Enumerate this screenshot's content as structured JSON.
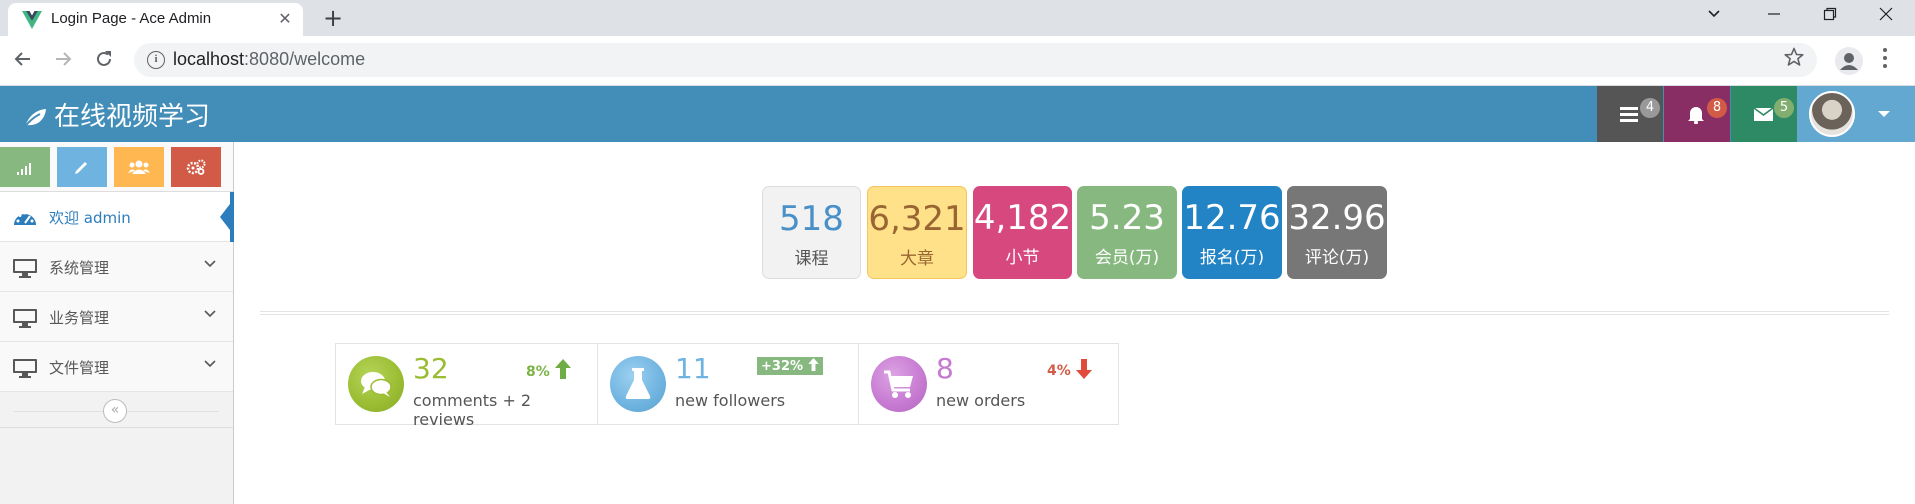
{
  "browser": {
    "tab_title": "Login Page - Ace Admin",
    "url_host": "localhost",
    "url_path": ":8080/welcome",
    "close_glyph": "✕",
    "new_tab_glyph": "+",
    "window_buttons": [
      "minimize",
      "restore",
      "close"
    ]
  },
  "navbar": {
    "brand": "在线视频学习",
    "badges": [
      {
        "icon": "tasks-icon",
        "count": "4",
        "color": "#555555"
      },
      {
        "icon": "bell-icon",
        "count": "8",
        "color": "#892e65"
      },
      {
        "icon": "envelope-icon",
        "count": "5",
        "color": "#2e8965"
      }
    ],
    "user_block_color": "#62a8d1"
  },
  "sidebar": {
    "shortcuts": [
      {
        "icon": "signal-icon",
        "color": "#87b87f"
      },
      {
        "icon": "pencil-icon",
        "color": "#6fb3e0"
      },
      {
        "icon": "users-icon",
        "color": "#ffb752"
      },
      {
        "icon": "cogs-icon",
        "color": "#d15b47"
      }
    ],
    "items": [
      {
        "label": "欢迎 admin",
        "icon": "dashboard-icon",
        "active": true
      },
      {
        "label": "系统管理",
        "icon": "desktop-icon"
      },
      {
        "label": "业务管理",
        "icon": "desktop-icon"
      },
      {
        "label": "文件管理",
        "icon": "desktop-icon"
      }
    ],
    "collapse_glyph": "«"
  },
  "stats": [
    {
      "value": "518",
      "label": "课程",
      "bg": "#f2f2f2",
      "color": "#4a90c8"
    },
    {
      "value": "6,321",
      "label": "大章",
      "bg": "#fee188",
      "color": "#996633"
    },
    {
      "value": "4,182",
      "label": "小节",
      "bg": "#d6487e",
      "color": "#ffffff"
    },
    {
      "value": "5.23",
      "label": "会员(万)",
      "bg": "#87b87f",
      "color": "#ffffff"
    },
    {
      "value": "12.76",
      "label": "报名(万)",
      "bg": "#2283c5",
      "color": "#ffffff"
    },
    {
      "value": "32.96",
      "label": "评论(万)",
      "bg": "#777777",
      "color": "#ffffff"
    }
  ],
  "infoboxes": [
    {
      "number": "32",
      "text": "comments + 2 reviews",
      "stat": "8%",
      "trend": "up",
      "color": "#9abc32",
      "icon": "comments-icon"
    },
    {
      "number": "11",
      "text": "new followers",
      "stat": "+32%",
      "trend": "up",
      "color": "#6fb3e0",
      "icon": "flask-icon"
    },
    {
      "number": "8",
      "text": "new orders",
      "stat": "4%",
      "trend": "down",
      "color": "#c679d0",
      "icon": "shopping-cart-icon"
    }
  ]
}
